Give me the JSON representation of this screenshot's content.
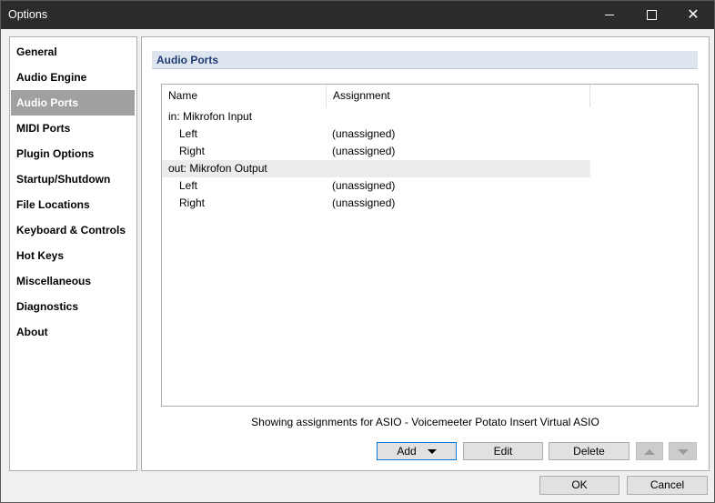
{
  "window": {
    "title": "Options",
    "minimize": "minimize-icon",
    "maximize": "maximize-icon",
    "close": "close-icon"
  },
  "sidebar": {
    "active": "Audio Ports",
    "items": [
      "General",
      "Audio Engine",
      "Audio Ports",
      "MIDI Ports",
      "Plugin Options",
      "Startup/Shutdown",
      "File Locations",
      "Keyboard & Controls",
      "Hot Keys",
      "Miscellaneous",
      "Diagnostics",
      "About"
    ]
  },
  "main": {
    "section_title": "Audio Ports",
    "columns": {
      "name": "Name",
      "assignment": "Assignment"
    },
    "rows": [
      {
        "name": "in: Mikrofon Input",
        "assignment": "",
        "indent": false
      },
      {
        "name": "Left",
        "assignment": "(unassigned)",
        "indent": true
      },
      {
        "name": "Right",
        "assignment": "(unassigned)",
        "indent": true
      },
      {
        "name": "out: Mikrofon Output",
        "assignment": "",
        "indent": false
      },
      {
        "name": "Left",
        "assignment": "(unassigned)",
        "indent": true
      },
      {
        "name": "Right",
        "assignment": "(unassigned)",
        "indent": true
      }
    ],
    "status": "Showing assignments for ASIO - Voicemeeter Potato Insert Virtual ASIO",
    "buttons": {
      "add": "Add",
      "edit": "Edit",
      "delete": "Delete"
    }
  },
  "footer": {
    "ok": "OK",
    "cancel": "Cancel"
  }
}
